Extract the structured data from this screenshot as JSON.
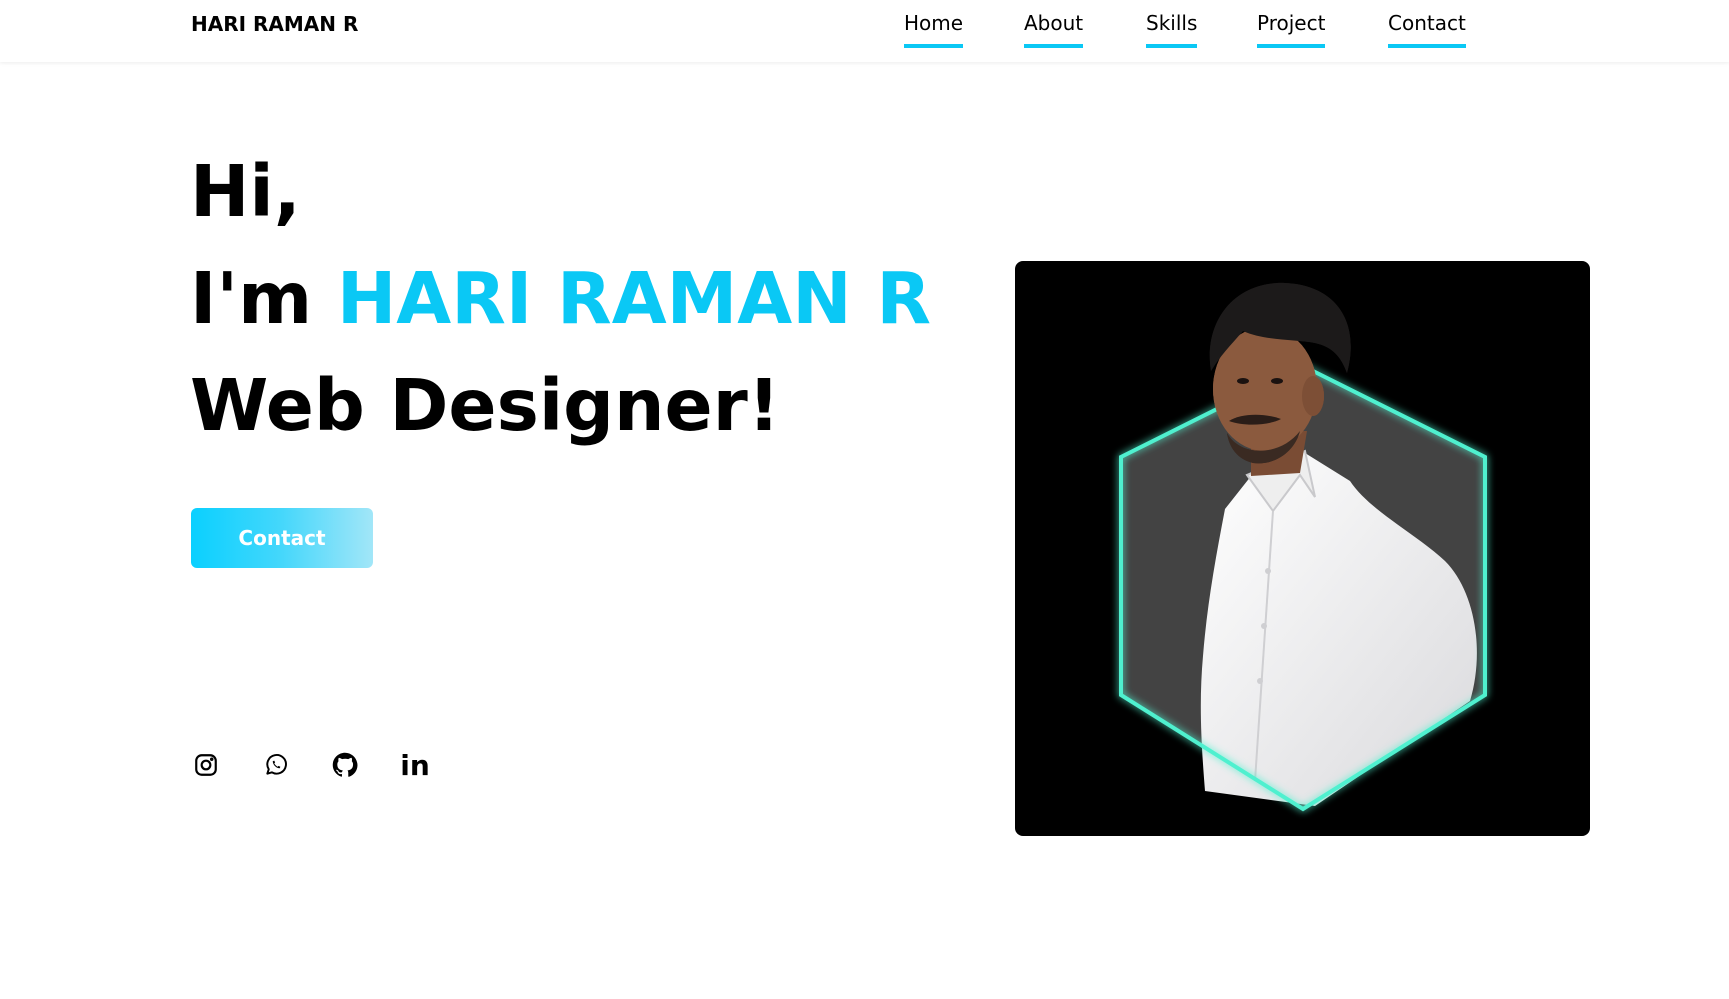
{
  "header": {
    "logo": "HARI RAMAN R",
    "nav": [
      {
        "label": "Home"
      },
      {
        "label": "About"
      },
      {
        "label": "Skills"
      },
      {
        "label": "Project"
      },
      {
        "label": "Contact"
      }
    ]
  },
  "hero": {
    "greeting": "Hi,",
    "intro_prefix": "I'm",
    "name": "HARI RAMAN R",
    "role": "Web Designer!",
    "cta_label": "Contact"
  },
  "social": [
    {
      "icon": "instagram-icon"
    },
    {
      "icon": "whatsapp-icon"
    },
    {
      "icon": "github-icon"
    },
    {
      "icon": "linkedin-icon",
      "glyph": "in"
    }
  ],
  "theme": {
    "accent": "#0ac8f5",
    "hex_border": "#4ff0cf",
    "card_bg": "#000000"
  }
}
